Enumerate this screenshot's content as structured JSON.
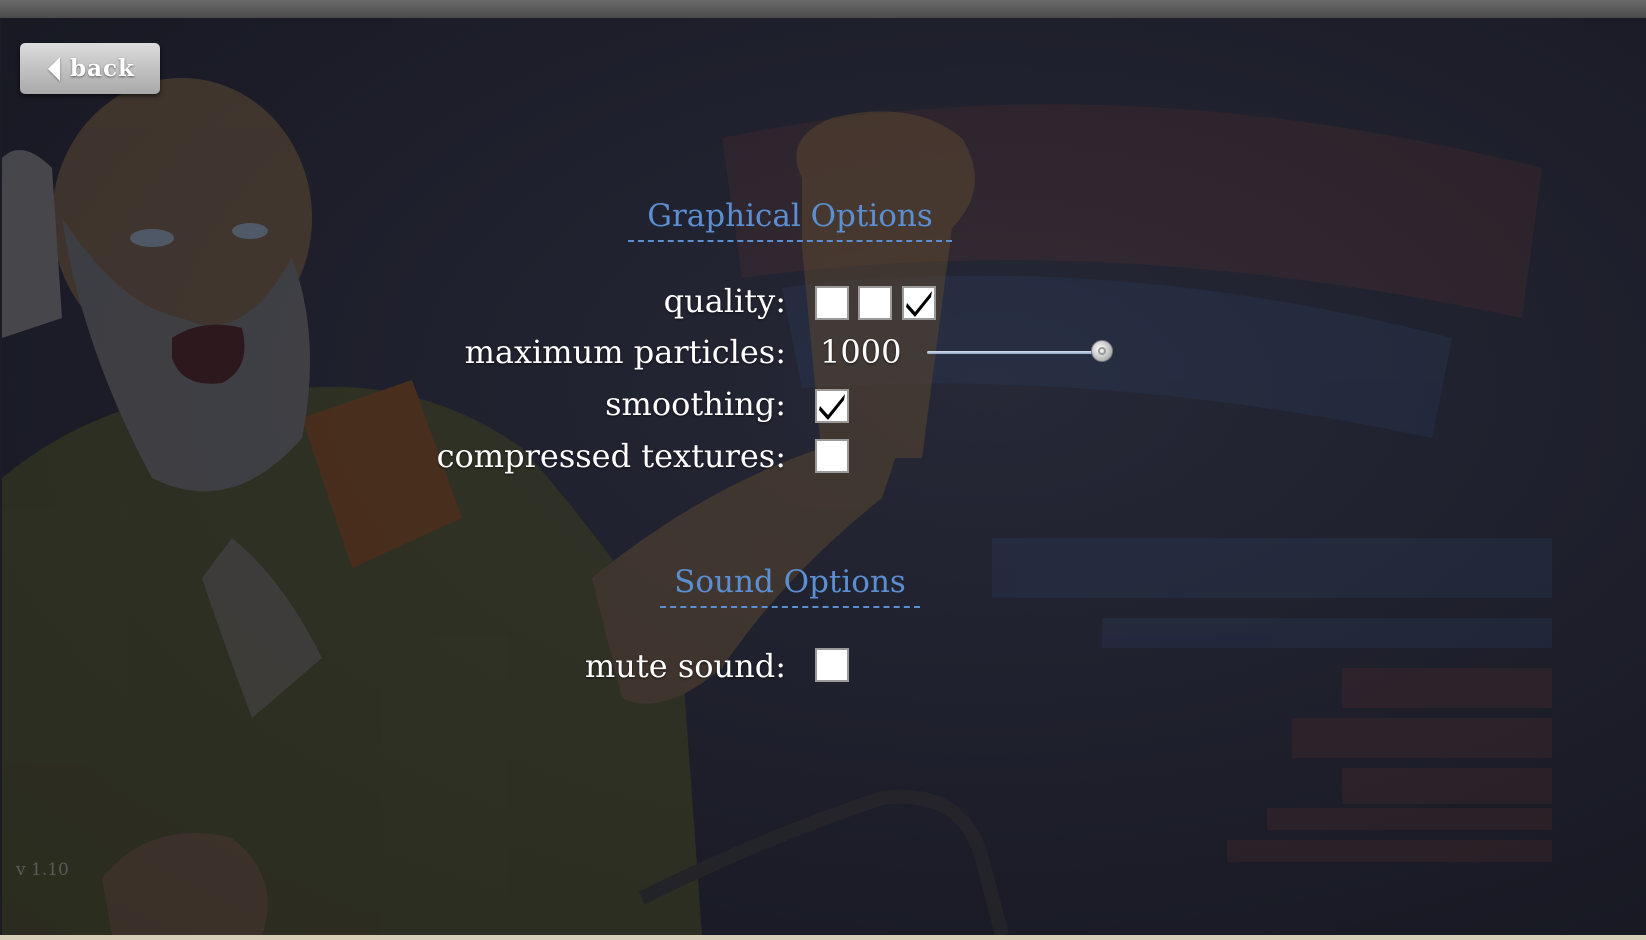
{
  "back_button": {
    "label": "back",
    "icon": "back-arrow-icon"
  },
  "graphical_options": {
    "title": "Graphical Options",
    "quality": {
      "label": "quality:",
      "levels": [
        false,
        false,
        true
      ]
    },
    "maximum_particles": {
      "label": "maximum particles:",
      "value": "1000",
      "slider_fraction": 1.0
    },
    "smoothing": {
      "label": "smoothing:",
      "checked": true
    },
    "compressed_textures": {
      "label": "compressed textures:",
      "checked": false
    }
  },
  "sound_options": {
    "title": "Sound Options",
    "mute_sound": {
      "label": "mute sound:",
      "checked": false
    }
  },
  "version": "v 1.10",
  "colors": {
    "section_title": "#5b8fd1",
    "label": "#ffffff",
    "background": "#1d1e2a"
  }
}
